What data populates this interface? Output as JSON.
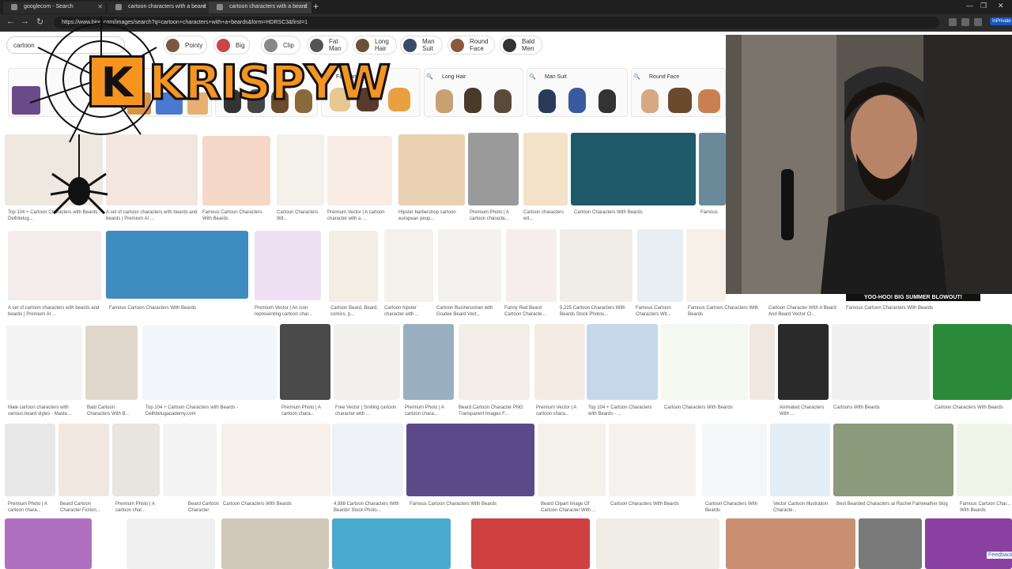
{
  "browser": {
    "tabs": [
      {
        "label": "googlecom - Search",
        "active": false
      },
      {
        "label": "cartoon characters with a beard",
        "active": false
      },
      {
        "label": "cartoon characters with a beard",
        "active": true
      }
    ],
    "new_tab": "+",
    "url": "https://www.bing.com/images/search?q=cartoon+characters+with+a+beards&form=HDRSC3&first=1",
    "inprivate_label": "InPrivate",
    "window_controls": [
      "—",
      "❐",
      "✕"
    ]
  },
  "search": {
    "query": "cartoon"
  },
  "filter_chips": [
    {
      "label": "Pointy",
      "label2": ""
    },
    {
      "label": "Big",
      "label2": ""
    },
    {
      "label": "Clip",
      "label2": ""
    },
    {
      "label": "Fat",
      "label2": "Man"
    },
    {
      "label": "Long",
      "label2": "Hair"
    },
    {
      "label": "Man",
      "label2": "Suit"
    },
    {
      "label": "Round",
      "label2": "Face"
    },
    {
      "label": "Bald",
      "label2": "Men"
    }
  ],
  "related_strips": [
    {
      "label": "Fat Man"
    },
    {
      "label": "Long Hair"
    },
    {
      "label": "Man Suit"
    },
    {
      "label": "Round Face"
    }
  ],
  "row1_captions": [
    "Top 104 + Cartoon Characters with Beards - Delhitelug...",
    "A set of cartoon characters with beards and beards | Premium Al ...",
    "Famous Cartoon Characters With Beards",
    "Cartoon Characters Wit...",
    "Premium Vector | A cartoon character with a ...",
    "Hipster barbershop cartoon european peop...",
    "Premium Photo | A cartoon characte...",
    "Cartoon characters wit...",
    "Cartoon Characters With Beards",
    "Famous C..."
  ],
  "row2_captions": [
    "A set of cartoon characters with beards and beards | Premium AI ...",
    "Famous Cartoon Characters With Beards",
    "Premium Vector | An icon representing cartoon char...",
    "Cartoon Beard, Beard, comics, p...",
    "Cartoon hipster character with ...",
    "Cartoon Businessman with Goatee Beard Vect...",
    "Funny Red Beard Cartoon Characte...",
    "5,225 Cartoon Characters With Beards Stock Photos...",
    "Famous Cartoon Characters Wit...",
    "Famous Cartoon Characters With Beards",
    "Cartoon Character With A Beard And Beard Vector Cl...",
    "Famous Cartoon Characters With Beards"
  ],
  "row3_captions": [
    "Male cartoon characters with various beard styles - Maste...",
    "Bald Cartoon Characters With B...",
    "Top 104 + Cartoon Characters with Beards - Delhitelugacademy.com",
    "Premium Photo | A cartoon chara...",
    "Free Vector | Smiling cartoon character with ...",
    "Premium Photo | A cartoon chara...",
    "Beard Cartoon Character PNG Transparent Images F...",
    "Premium Vector | A cartoon chara...",
    "Top 104 + Cartoon Characters with Beards - ...",
    "Cartoon Characters With Beards",
    "Animated Characters With ...",
    "Cartoons With Beards",
    "Cartoon Characters With Beards"
  ],
  "row4_captions": [
    "Premium Photo | A cartoon chara...",
    "Beard Cartoon Character Fiction...",
    "Premium Photo | A cartoon char...",
    "Beard Cartoon Character Drawin...",
    "Cartoon Characters With Beards",
    "4,988 Cartoon Characters With Beards! Stock Photo...",
    "Famous Cartoon Characters With Beards",
    "Beard Clipart Image Of Cartoon Character With ...",
    "Cartoon Characters With Beards",
    "Cartoon Characters With Beards",
    "Vector Cartoon Illustration Characte...",
    "Best Bearded Characters at Rachel Fairweather blog",
    "Famous Cartoon Char... With Beards"
  ],
  "overlay": {
    "logo_k": "K",
    "logo_text": "KRISPYW",
    "banner": "YOO-HOO! BIG SUMMER BLOWOUT!",
    "feedback": "Feedback"
  }
}
